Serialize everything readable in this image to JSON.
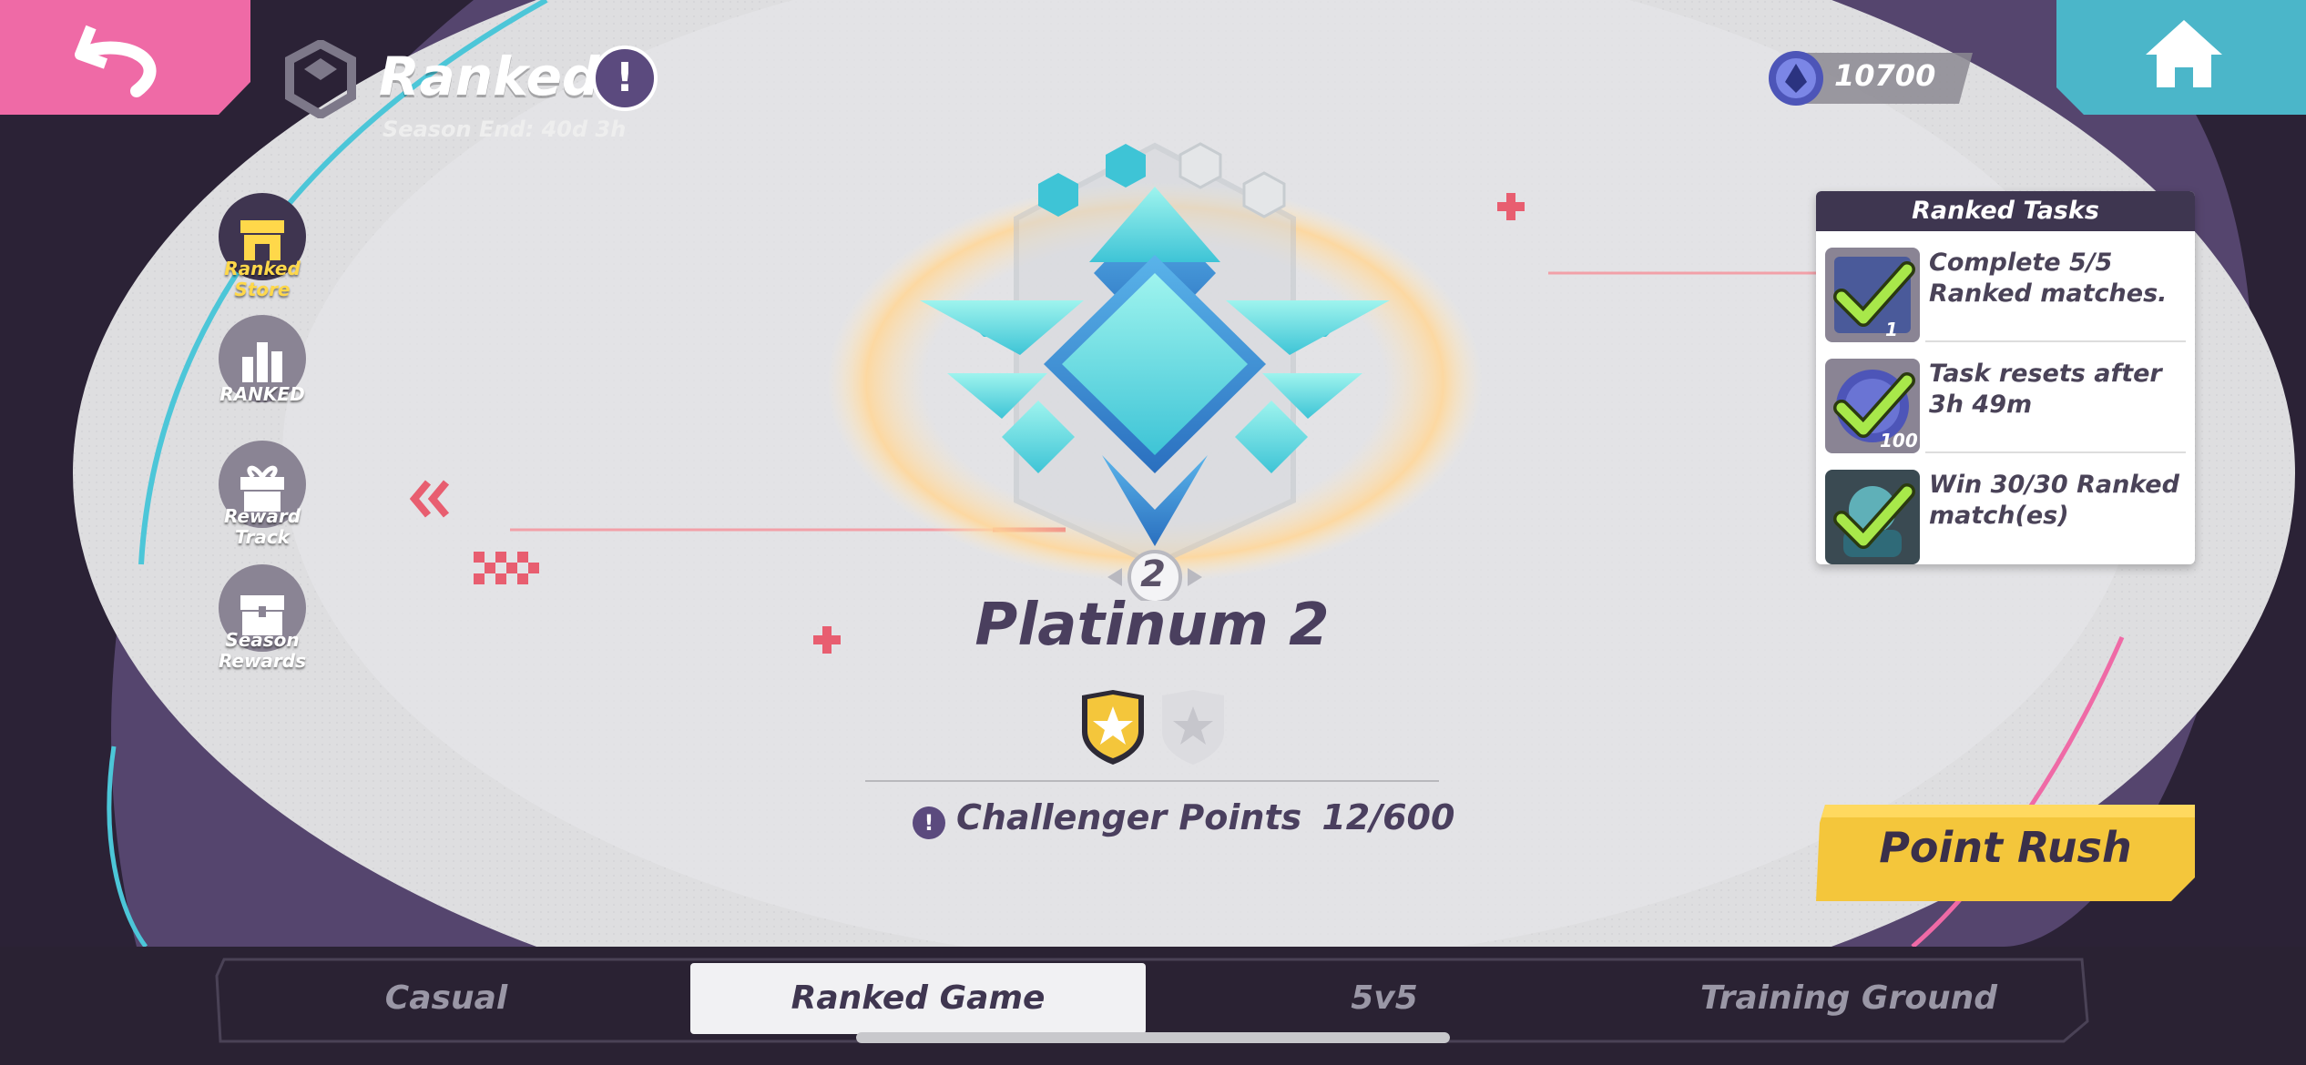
{
  "header": {
    "title": "Ranked",
    "title_badge": "!",
    "season_end": "Season End: 40d 3h"
  },
  "currency": {
    "value": "10700",
    "icon": "rank-coin-icon"
  },
  "nav": {
    "back_icon": "back-arrow-icon",
    "home_icon": "home-icon"
  },
  "sidebar": {
    "items": [
      {
        "label": "Ranked Store",
        "icon": "store-icon",
        "color": "#ffd84a"
      },
      {
        "label": "RANKED",
        "icon": "leaderboard-icon",
        "color": "#ffffff"
      },
      {
        "label": "Reward Track",
        "icon": "gift-icon",
        "color": "#ffffff"
      },
      {
        "label": "Season Rewards",
        "icon": "chest-icon",
        "color": "#ffffff"
      }
    ]
  },
  "rank": {
    "tier": "Platinum 2",
    "division_number": "2",
    "stars_filled": 1,
    "stars_total": 2
  },
  "challenger": {
    "label": "Challenger Points",
    "value": "12/600",
    "icon": "info-icon"
  },
  "tasks": {
    "title": "Ranked Tasks",
    "items": [
      {
        "text": "Complete 5/5 Ranked matches.",
        "reward": "1",
        "done": true
      },
      {
        "text": "Task resets after 3h 49m",
        "reward": "100",
        "done": true
      },
      {
        "text": "Win 30/30 Ranked match(es)",
        "reward": "",
        "done": true
      }
    ]
  },
  "point_rush": {
    "label": "Point Rush"
  },
  "tabs": [
    {
      "label": "Casual",
      "active": false
    },
    {
      "label": "Ranked Game",
      "active": true
    },
    {
      "label": "5v5",
      "active": false
    },
    {
      "label": "Training Ground",
      "active": false
    }
  ],
  "colors": {
    "accent_pink": "#ef6aa6",
    "accent_teal": "#4bb6c9",
    "accent_yellow": "#f4c63b",
    "platinum": "#6fe0e0"
  }
}
